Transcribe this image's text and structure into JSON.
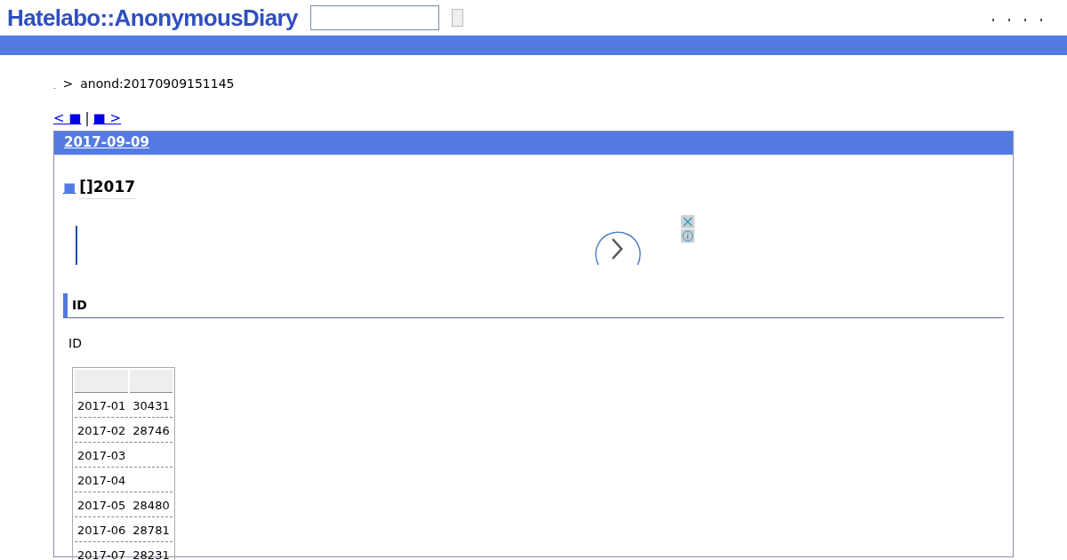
{
  "header": {
    "logo": "Hatelabo::AnonymousDiary",
    "search": {
      "kind": "field"
    }
  },
  "breadcrumb": {
    "home": ".",
    "separator": ">",
    "current": "anond:20170909151145"
  },
  "pager": {
    "prev": "< ■",
    "divider": "|",
    "next": "■ >"
  },
  "day": {
    "date": "2017-09-09",
    "entry": {
      "anchor": "■",
      "title": "[]2017",
      "section": {
        "heading": "ID",
        "text": "ID",
        "table": {
          "rows": [
            {
              "month": "2017-01",
              "count": "30431"
            },
            {
              "month": "2017-02",
              "count": "28746"
            },
            {
              "month": "2017-03"
            },
            {
              "month": "2017-04"
            },
            {
              "month": "2017-05",
              "count": "28480"
            },
            {
              "month": "2017-06",
              "count": "28781"
            },
            {
              "month": "2017-07",
              "count": "28231"
            }
          ]
        }
      }
    }
  }
}
